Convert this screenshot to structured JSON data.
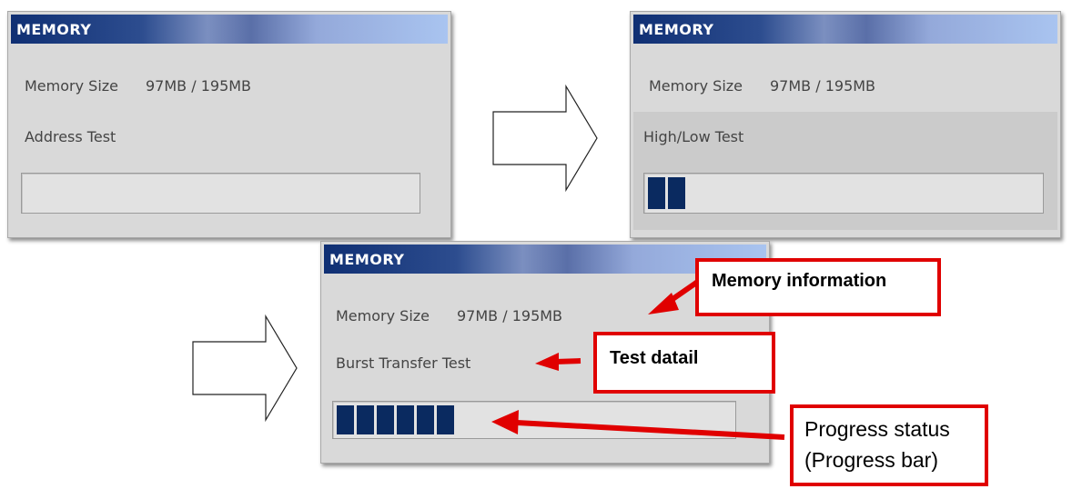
{
  "panels": [
    {
      "title": "MEMORY",
      "memory_label": "Memory Size",
      "memory_value": "97MB / 195MB",
      "test_name": "Address Test",
      "progress_blocks": 0
    },
    {
      "title": "MEMORY",
      "memory_label": "Memory Size",
      "memory_value": "97MB / 195MB",
      "test_name": "High/Low Test",
      "progress_blocks": 2
    },
    {
      "title": "MEMORY",
      "memory_label": "Memory Size",
      "memory_value": "97MB / 195MB",
      "test_name": "Burst Transfer Test",
      "progress_blocks": 6
    }
  ],
  "annotations": {
    "memory_info": "Memory information",
    "test_detail": "Test datail",
    "progress_line1": "Progress status",
    "progress_line2": "(Progress bar)"
  },
  "colors": {
    "annotation_red": "#e00000",
    "progress_block": "#0a2a60",
    "panel_bg": "#d9d9d9"
  },
  "icons": [
    "right-arrow-icon",
    "red-pointer-arrow-icon"
  ]
}
